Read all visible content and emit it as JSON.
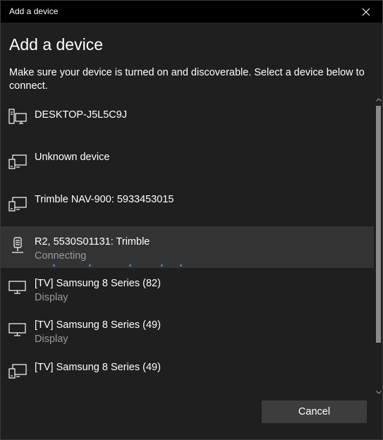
{
  "window": {
    "title": "Add a device"
  },
  "dialog": {
    "heading": "Add a device",
    "instructions": "Make sure your device is turned on and discoverable. Select a device below to connect."
  },
  "devices": [
    {
      "name": "DESKTOP-J5L5C9J",
      "subtitle": "",
      "icon": "desktop-computer-icon",
      "state": "normal"
    },
    {
      "name": "Unknown device",
      "subtitle": "",
      "icon": "generic-device-icon",
      "state": "normal"
    },
    {
      "name": "Trimble NAV-900: 5933453015",
      "subtitle": "",
      "icon": "generic-device-icon",
      "state": "normal"
    },
    {
      "name": "R2, 5530S01131: Trimble",
      "subtitle": "Connecting",
      "icon": "receiver-device-icon",
      "state": "connecting"
    },
    {
      "name": "[TV] Samsung 8 Series (82)",
      "subtitle": "Display",
      "icon": "display-monitor-icon",
      "state": "normal"
    },
    {
      "name": "[TV] Samsung 8 Series (49)",
      "subtitle": "Display",
      "icon": "display-monitor-icon",
      "state": "normal"
    },
    {
      "name": "[TV] Samsung 8 Series (49)",
      "subtitle": "",
      "icon": "generic-device-icon",
      "state": "normal"
    }
  ],
  "buttons": {
    "cancel": "Cancel"
  },
  "colors": {
    "background": "#1f1f1f",
    "titlebar": "#000000",
    "selected_row": "#333333",
    "progress_accent": "#2f8ee6",
    "secondary_text": "#9a9a9a"
  }
}
